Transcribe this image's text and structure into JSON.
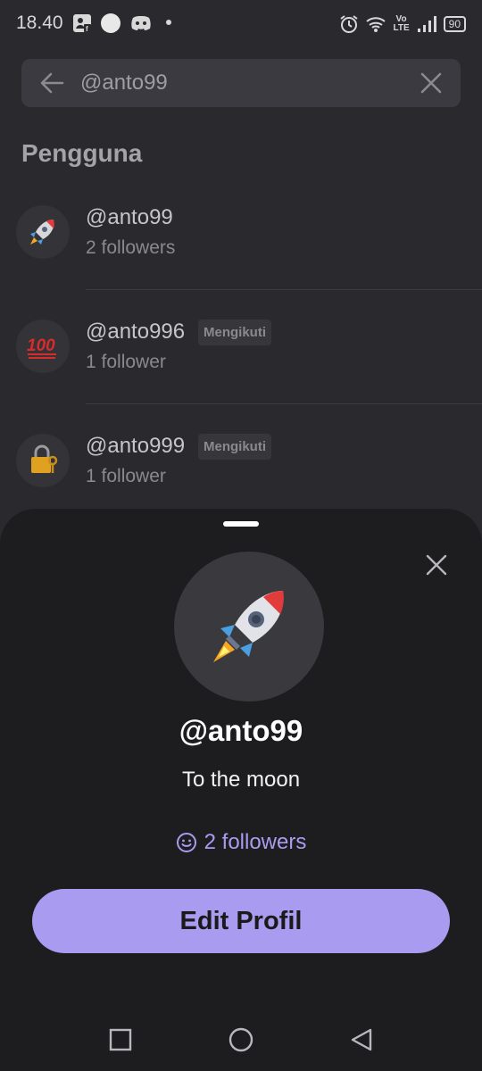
{
  "status_bar": {
    "time": "18.40",
    "volte_top": "Vo",
    "volte_bottom": "LTE",
    "battery": "90"
  },
  "search": {
    "query": "@anto99"
  },
  "section_title": "Pengguna",
  "users": [
    {
      "handle": "@anto99",
      "followers": "2 followers",
      "badge": "",
      "avatar": "rocket-emoji"
    },
    {
      "handle": "@anto996",
      "followers": "1 follower",
      "badge": "Mengikuti",
      "avatar": "hundred-points-emoji"
    },
    {
      "handle": "@anto999",
      "followers": "1 follower",
      "badge": "Mengikuti",
      "avatar": "locked-with-key-emoji"
    }
  ],
  "profile_sheet": {
    "handle": "@anto99",
    "bio": "To the moon",
    "followers": "2 followers",
    "edit_button": "Edit Profil",
    "accent": "#a99cf0"
  },
  "nav": {
    "icons": [
      "recents-square-icon",
      "home-circle-icon",
      "back-triangle-icon"
    ]
  }
}
